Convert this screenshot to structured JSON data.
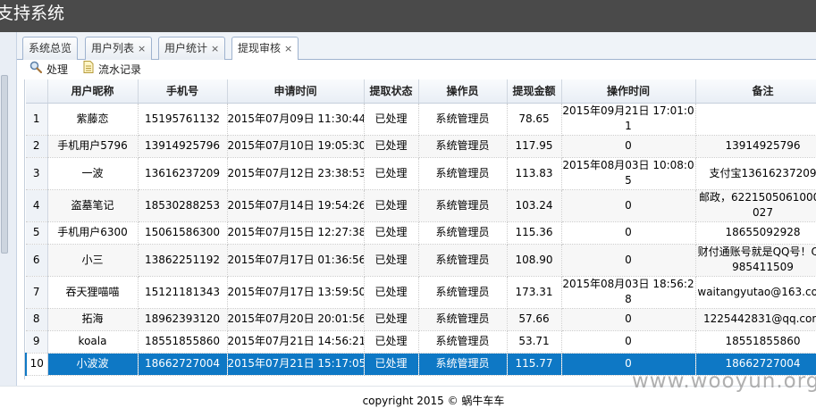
{
  "app": {
    "title": "支持系统"
  },
  "tabs": [
    {
      "label": "系统总览",
      "closable": false,
      "active": false
    },
    {
      "label": "用户列表",
      "closable": true,
      "active": false
    },
    {
      "label": "用户统计",
      "closable": true,
      "active": false
    },
    {
      "label": "提现审核",
      "closable": true,
      "active": true
    }
  ],
  "close_glyph": "×",
  "toolbar": {
    "process_label": "处理",
    "process_icon": "magnifier-icon",
    "log_label": "流水记录",
    "log_icon": "document-icon"
  },
  "table": {
    "columns": [
      "",
      "用户昵称",
      "手机号",
      "申请时间",
      "提取状态",
      "操作员",
      "提现金额",
      "操作时间",
      "备注"
    ],
    "rows": [
      {
        "no": "1",
        "nickname": "紫藤恋",
        "phone": "15195761132",
        "apply_time": "2015年07月09日 11:30:44",
        "status": "已处理",
        "operator": "系统管理员",
        "amount": "78.65",
        "op_time": "2015年09月21日 17:01:01",
        "note": ""
      },
      {
        "no": "2",
        "nickname": "手机用户5796",
        "phone": "13914925796",
        "apply_time": "2015年07月10日 19:05:30",
        "status": "已处理",
        "operator": "系统管理员",
        "amount": "117.95",
        "op_time": "0",
        "note": "13914925796"
      },
      {
        "no": "3",
        "nickname": "一波",
        "phone": "13616237209",
        "apply_time": "2015年07月12日 23:38:53",
        "status": "已处理",
        "operator": "系统管理员",
        "amount": "113.83",
        "op_time": "2015年08月03日 10:08:05",
        "note": "支付宝13616237209"
      },
      {
        "no": "4",
        "nickname": "盗墓笔记",
        "phone": "18530288253",
        "apply_time": "2015年07月14日 19:54:26",
        "status": "已处理",
        "operator": "系统管理员",
        "amount": "103.24",
        "op_time": "0",
        "note": "邮政，62215050610009027"
      },
      {
        "no": "5",
        "nickname": "手机用户6300",
        "phone": "15061586300",
        "apply_time": "2015年07月15日 12:27:38",
        "status": "已处理",
        "operator": "系统管理员",
        "amount": "115.36",
        "op_time": "0",
        "note": "18655092928"
      },
      {
        "no": "6",
        "nickname": "小三",
        "phone": "13862251192",
        "apply_time": "2015年07月17日 01:36:56",
        "status": "已处理",
        "operator": "系统管理员",
        "amount": "108.90",
        "op_time": "0",
        "note": "财付通账号就是QQ号！QQ985411509"
      },
      {
        "no": "7",
        "nickname": "吞天狸喵喵",
        "phone": "15121181343",
        "apply_time": "2015年07月17日 13:59:50",
        "status": "已处理",
        "operator": "系统管理员",
        "amount": "173.31",
        "op_time": "2015年08月03日 18:56:28",
        "note": "waitangyutao@163.com"
      },
      {
        "no": "8",
        "nickname": "拓海",
        "phone": "18962393120",
        "apply_time": "2015年07月20日 20:01:56",
        "status": "已处理",
        "operator": "系统管理员",
        "amount": "57.66",
        "op_time": "0",
        "note": "1225442831@qq.com"
      },
      {
        "no": "9",
        "nickname": "koala",
        "phone": "18551855860",
        "apply_time": "2015年07月21日 14:56:21",
        "status": "已处理",
        "operator": "系统管理员",
        "amount": "53.71",
        "op_time": "0",
        "note": "18551855860"
      },
      {
        "no": "10",
        "nickname": "小波波",
        "phone": "18662727004",
        "apply_time": "2015年07月21日 15:17:05",
        "status": "已处理",
        "operator": "系统管理员",
        "amount": "115.77",
        "op_time": "0",
        "note": "18662727004"
      }
    ]
  },
  "footer": {
    "copyright": "copyright 2015 © 蜗牛车车"
  },
  "watermark": "www.wooyun.org",
  "colors": {
    "selected_row": "#0e78c5",
    "topbar": "#4a4a4a"
  }
}
